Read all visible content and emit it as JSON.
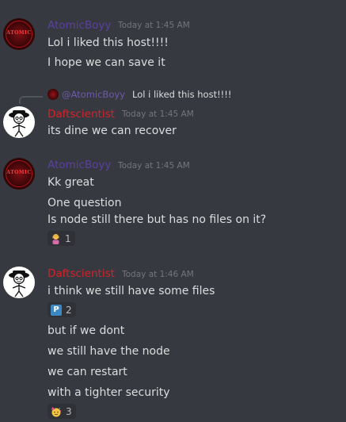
{
  "colors": {
    "background": "#36393f",
    "username_purple": "#5d3fa3",
    "username_red": "#d6222a",
    "timestamp": "#72767d",
    "text": "#dcddde",
    "reaction_bg": "#2f3136"
  },
  "messages": [
    {
      "author": "AtomicBoyy",
      "timestamp": "Today at 1:45 AM",
      "avatar_text": "ATOMIC",
      "lines": [
        "Lol i liked this host!!!!",
        "I hope we can save it"
      ]
    },
    {
      "reply_to": {
        "mention": "@AtomicBoyy",
        "text": "Lol i liked this host!!!!"
      },
      "author": "Daftscientist",
      "timestamp": "Today at 1:45 AM",
      "lines": [
        "its dine we can recover"
      ]
    },
    {
      "author": "AtomicBoyy",
      "timestamp": "Today at 1:45 AM",
      "avatar_text": "ATOMIC",
      "lines": [
        "Kk great",
        "One question",
        "Is node still there but has no files on it?"
      ],
      "reactions": [
        {
          "icon": "person-tipping-hand-emoji",
          "count": "1"
        }
      ]
    },
    {
      "author": "Daftscientist",
      "timestamp": "Today at 1:46 AM",
      "lines": [
        "i think we still have some files",
        "but if we dont",
        "we still have the node",
        "we can restart",
        "with a tighter security"
      ],
      "reactions": [
        {
          "icon": "p-button-emoji",
          "label": "P",
          "count": "2"
        },
        {
          "icon": "partying-face-emoji",
          "count": "3"
        }
      ]
    }
  ]
}
